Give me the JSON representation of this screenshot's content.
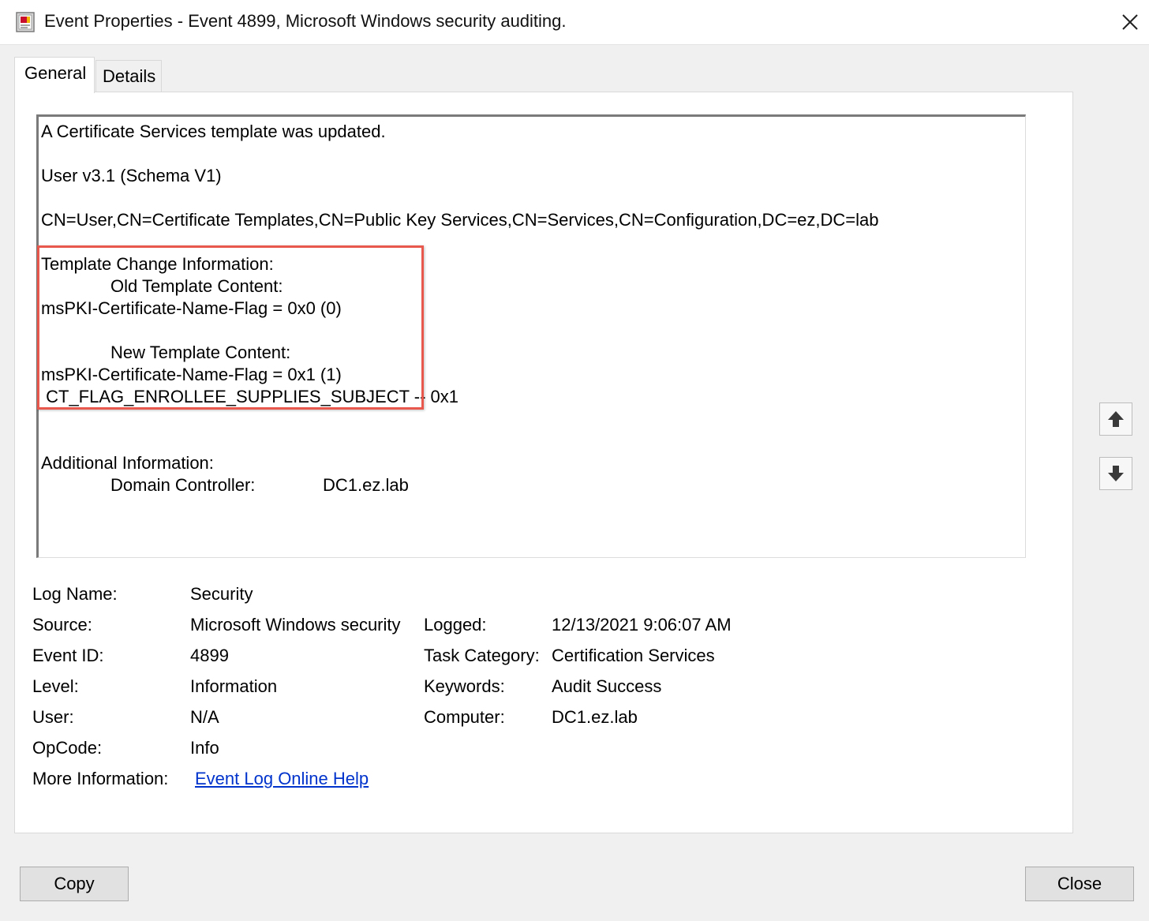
{
  "window": {
    "title": "Event Properties - Event 4899, Microsoft Windows security auditing."
  },
  "tabs": [
    {
      "label": "General",
      "active": true
    },
    {
      "label": "Details",
      "active": false
    }
  ],
  "description": {
    "lines": [
      "A Certificate Services template was updated.",
      "User v3.1 (Schema V1)",
      "CN=User,CN=Certificate Templates,CN=Public Key Services,CN=Services,CN=Configuration,DC=ez,DC=lab",
      "Template Change Information:",
      "Old Template Content:",
      "msPKI-Certificate-Name-Flag = 0x0 (0)",
      "New Template Content:",
      "msPKI-Certificate-Name-Flag = 0x1 (1)",
      " CT_FLAG_ENROLLEE_SUPPLIES_SUBJECT -- 0x1",
      "Additional Information:",
      "Domain Controller:",
      "DC1.ez.lab"
    ],
    "highlight_color": "#e8584d"
  },
  "info": {
    "log_name": {
      "label": "Log Name:",
      "value": "Security"
    },
    "source": {
      "label": "Source:",
      "value": "Microsoft Windows security"
    },
    "logged": {
      "label": "Logged:",
      "value": "12/13/2021 9:06:07 AM"
    },
    "event_id": {
      "label": "Event ID:",
      "value": "4899"
    },
    "task_category": {
      "label": "Task Category:",
      "value": "Certification Services"
    },
    "level": {
      "label": "Level:",
      "value": "Information"
    },
    "keywords": {
      "label": "Keywords:",
      "value": "Audit Success"
    },
    "user": {
      "label": "User:",
      "value": "N/A"
    },
    "computer": {
      "label": "Computer:",
      "value": "DC1.ez.lab"
    },
    "opcode": {
      "label": "OpCode:",
      "value": "Info"
    },
    "more_info": {
      "label": "More Information:",
      "link": "Event Log Online Help"
    }
  },
  "buttons": {
    "copy": "Copy",
    "close": "Close"
  },
  "icons": {
    "app": "event-viewer-icon",
    "close": "close-icon",
    "up": "arrow-up-icon",
    "down": "arrow-down-icon"
  },
  "colors": {
    "link": "#0033cc",
    "highlight": "#e8584d"
  }
}
